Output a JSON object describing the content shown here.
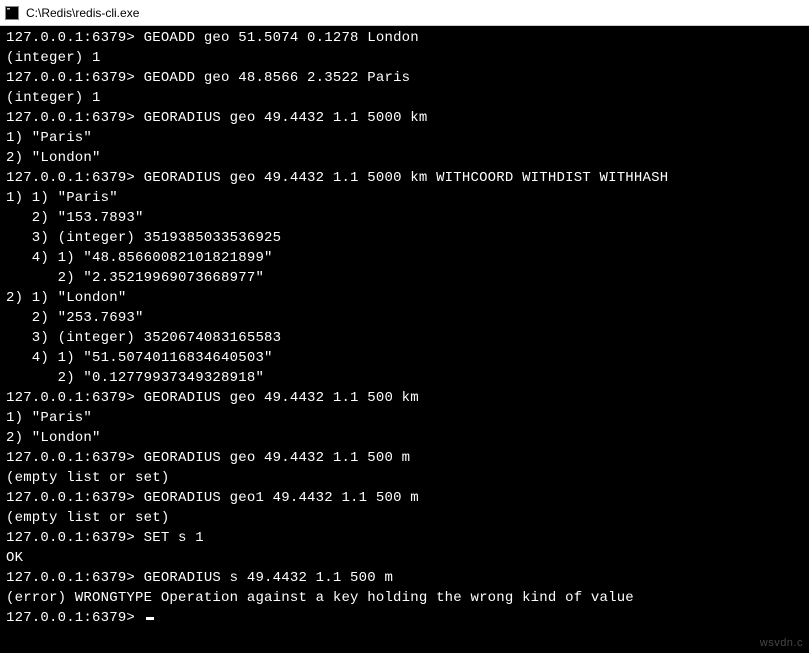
{
  "window": {
    "title": "C:\\Redis\\redis-cli.exe"
  },
  "prompt": "127.0.0.1:6379>",
  "lines": [
    {
      "type": "cmd",
      "text": "GEOADD geo 51.5074 0.1278 London"
    },
    {
      "type": "out",
      "text": "(integer) 1"
    },
    {
      "type": "cmd",
      "text": "GEOADD geo 48.8566 2.3522 Paris"
    },
    {
      "type": "out",
      "text": "(integer) 1"
    },
    {
      "type": "cmd",
      "text": "GEORADIUS geo 49.4432 1.1 5000 km"
    },
    {
      "type": "out",
      "text": "1) \"Paris\""
    },
    {
      "type": "out",
      "text": "2) \"London\""
    },
    {
      "type": "cmd",
      "text": "GEORADIUS geo 49.4432 1.1 5000 km WITHCOORD WITHDIST WITHHASH"
    },
    {
      "type": "out",
      "text": "1) 1) \"Paris\""
    },
    {
      "type": "out",
      "text": "   2) \"153.7893\""
    },
    {
      "type": "out",
      "text": "   3) (integer) 3519385033536925"
    },
    {
      "type": "out",
      "text": "   4) 1) \"48.85660082101821899\""
    },
    {
      "type": "out",
      "text": "      2) \"2.35219969073668977\""
    },
    {
      "type": "out",
      "text": "2) 1) \"London\""
    },
    {
      "type": "out",
      "text": "   2) \"253.7693\""
    },
    {
      "type": "out",
      "text": "   3) (integer) 3520674083165583"
    },
    {
      "type": "out",
      "text": "   4) 1) \"51.50740116834640503\""
    },
    {
      "type": "out",
      "text": "      2) \"0.12779937349328918\""
    },
    {
      "type": "cmd",
      "text": "GEORADIUS geo 49.4432 1.1 500 km"
    },
    {
      "type": "out",
      "text": "1) \"Paris\""
    },
    {
      "type": "out",
      "text": "2) \"London\""
    },
    {
      "type": "cmd",
      "text": "GEORADIUS geo 49.4432 1.1 500 m"
    },
    {
      "type": "out",
      "text": "(empty list or set)"
    },
    {
      "type": "cmd",
      "text": "GEORADIUS geo1 49.4432 1.1 500 m"
    },
    {
      "type": "out",
      "text": "(empty list or set)"
    },
    {
      "type": "cmd",
      "text": "SET s 1"
    },
    {
      "type": "out",
      "text": "OK"
    },
    {
      "type": "cmd",
      "text": "GEORADIUS s 49.4432 1.1 500 m"
    },
    {
      "type": "out",
      "text": "(error) WRONGTYPE Operation against a key holding the wrong kind of value"
    },
    {
      "type": "prompt-only",
      "text": ""
    }
  ],
  "watermark": "wsvdn.c"
}
